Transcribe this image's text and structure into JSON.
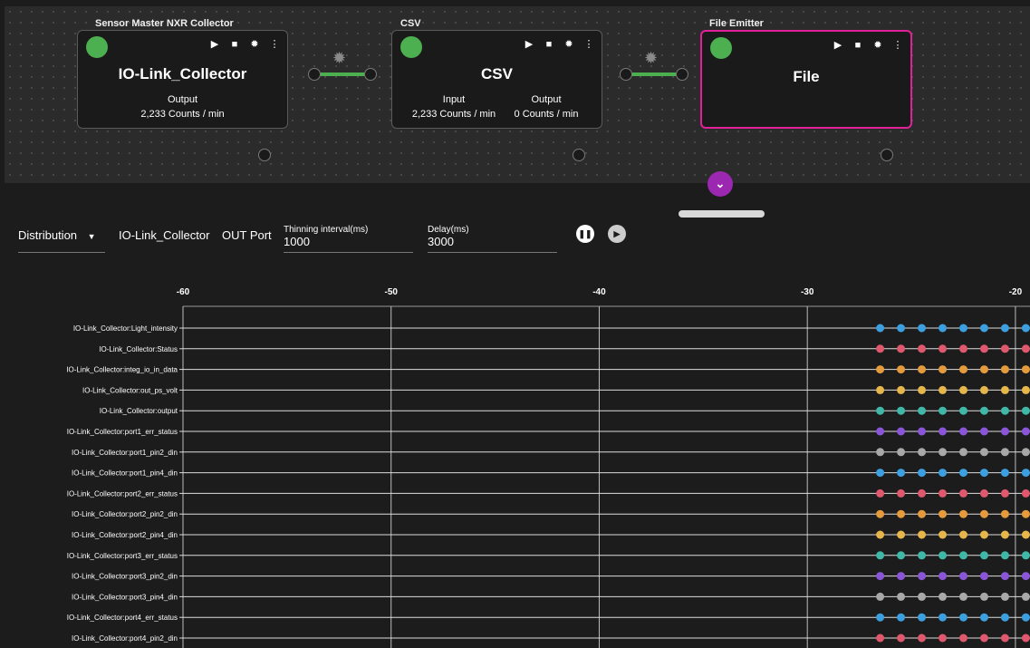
{
  "pipeline": {
    "nodes": [
      {
        "title": "Sensor Master NXR Collector",
        "name": "IO-Link_Collector",
        "output_label": "Output",
        "output_value": "2,233 Counts / min"
      },
      {
        "title": "CSV",
        "name": "CSV",
        "input_label": "Input",
        "input_value": "2,233 Counts / min",
        "output_label": "Output",
        "output_value": "0 Counts / min"
      },
      {
        "title": "File Emitter",
        "name": "File"
      }
    ],
    "collapse_icon": "chevron-down-icon",
    "accent_color": "#9c27b0",
    "selected_color": "#e0219a",
    "status_color": "#4caf50"
  },
  "controls": {
    "mode": "Distribution",
    "component": "IO-Link_Collector",
    "port": "OUT Port",
    "thinning_label": "Thinning interval(ms)",
    "thinning_value": "1000",
    "delay_label": "Delay(ms)",
    "delay_value": "3000"
  },
  "chart_data": {
    "type": "scatter",
    "x_ticks": [
      "-60",
      "-50",
      "-40",
      "-30",
      "-20"
    ],
    "xlim": [
      -60,
      -19.3
    ],
    "series": [
      {
        "name": "IO-Link_Collector:Light_intensity",
        "color": "#3b9fe0"
      },
      {
        "name": "IO-Link_Collector:Status",
        "color": "#e0586e"
      },
      {
        "name": "IO-Link_Collector:integ_io_in_data",
        "color": "#e59a3c"
      },
      {
        "name": "IO-Link_Collector:out_ps_volt",
        "color": "#e6b64a"
      },
      {
        "name": "IO-Link_Collector:output",
        "color": "#3fb8a8"
      },
      {
        "name": "IO-Link_Collector:port1_err_status",
        "color": "#8a55d8"
      },
      {
        "name": "IO-Link_Collector:port1_pin2_din",
        "color": "#a8a8a8"
      },
      {
        "name": "IO-Link_Collector:port1_pin4_din",
        "color": "#3b9fe0"
      },
      {
        "name": "IO-Link_Collector:port2_err_status",
        "color": "#e0586e"
      },
      {
        "name": "IO-Link_Collector:port2_pin2_din",
        "color": "#e59a3c"
      },
      {
        "name": "IO-Link_Collector:port2_pin4_din",
        "color": "#e6b64a"
      },
      {
        "name": "IO-Link_Collector:port3_err_status",
        "color": "#3fb8a8"
      },
      {
        "name": "IO-Link_Collector:port3_pin2_din",
        "color": "#8a55d8"
      },
      {
        "name": "IO-Link_Collector:port3_pin4_din",
        "color": "#a8a8a8"
      },
      {
        "name": "IO-Link_Collector:port4_err_status",
        "color": "#3b9fe0"
      },
      {
        "name": "IO-Link_Collector:port4_pin2_din",
        "color": "#e0586e"
      }
    ],
    "point_x": [
      -26.5,
      -25.5,
      -24.5,
      -23.5,
      -22.5,
      -21.5,
      -20.5,
      -19.5
    ]
  }
}
